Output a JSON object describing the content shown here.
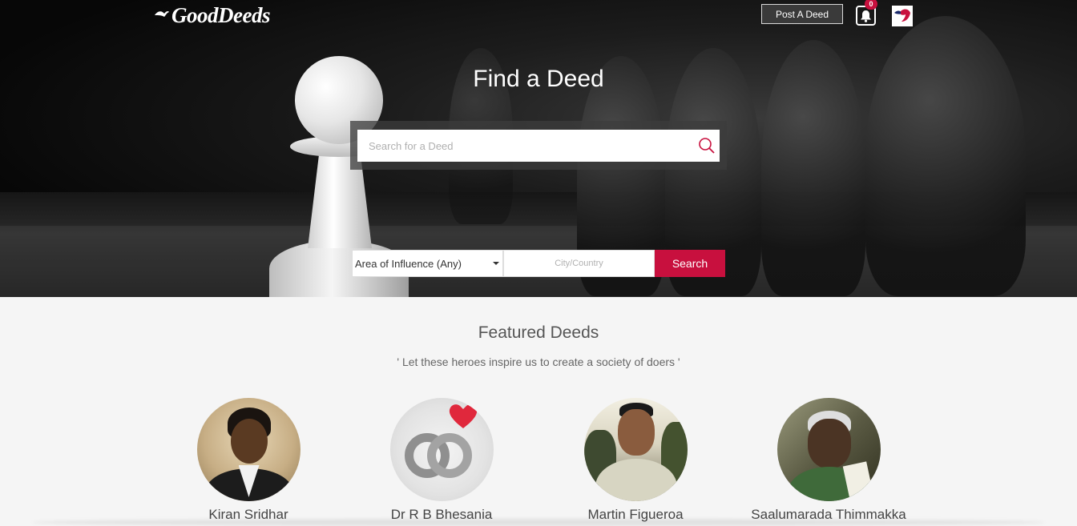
{
  "header": {
    "logo_text": "GoodDeeds",
    "post_button": "Post A Deed",
    "notification_count": "0"
  },
  "hero": {
    "title": "Find a Deed",
    "search_placeholder": "Search for a Deed",
    "area_select": "Area of Influence (Any)",
    "city_placeholder": "City/Country",
    "search_button": "Search"
  },
  "featured": {
    "title": "Featured Deeds",
    "subtitle": "' Let these heroes inspire us to create a society of doers '",
    "people": [
      {
        "name": "Kiran Sridhar"
      },
      {
        "name": "Dr R B Bhesania"
      },
      {
        "name": "Martin Figueroa"
      },
      {
        "name": "Saalumarada Thimmakka"
      }
    ]
  },
  "colors": {
    "accent": "#c8103e"
  }
}
